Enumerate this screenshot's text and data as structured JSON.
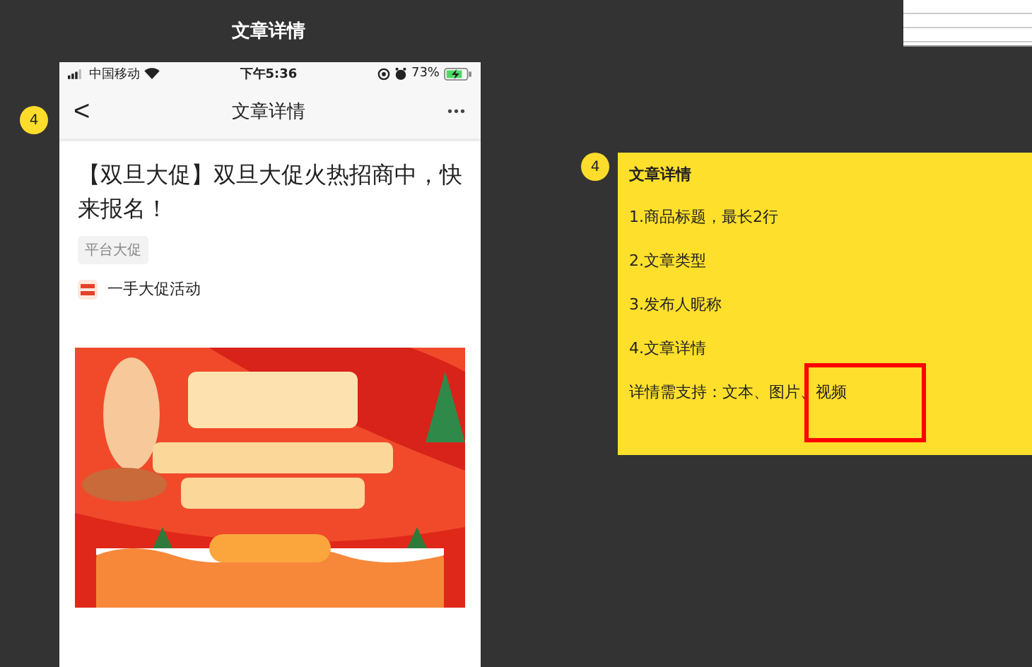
{
  "page_title": "文章详情",
  "phone": {
    "status_bar": {
      "carrier": "中国移动",
      "time": "下午5:36",
      "battery": "73%"
    },
    "nav": {
      "back": "<",
      "title": "文章详情",
      "more": "•••"
    },
    "article": {
      "title": "【双旦大促】双旦大促火热招商中，快来报名！",
      "tag": "平台大促",
      "author": "一手大促活动"
    }
  },
  "badges": [
    {
      "label": "4"
    },
    {
      "label": "4"
    }
  ],
  "note": {
    "heading": "文章详情",
    "lines": [
      "1.商品标题，最长2行",
      "2.文章类型",
      "3.发布人昵称",
      "4.文章详情",
      "详情需支持：文本、图片、视频"
    ]
  }
}
